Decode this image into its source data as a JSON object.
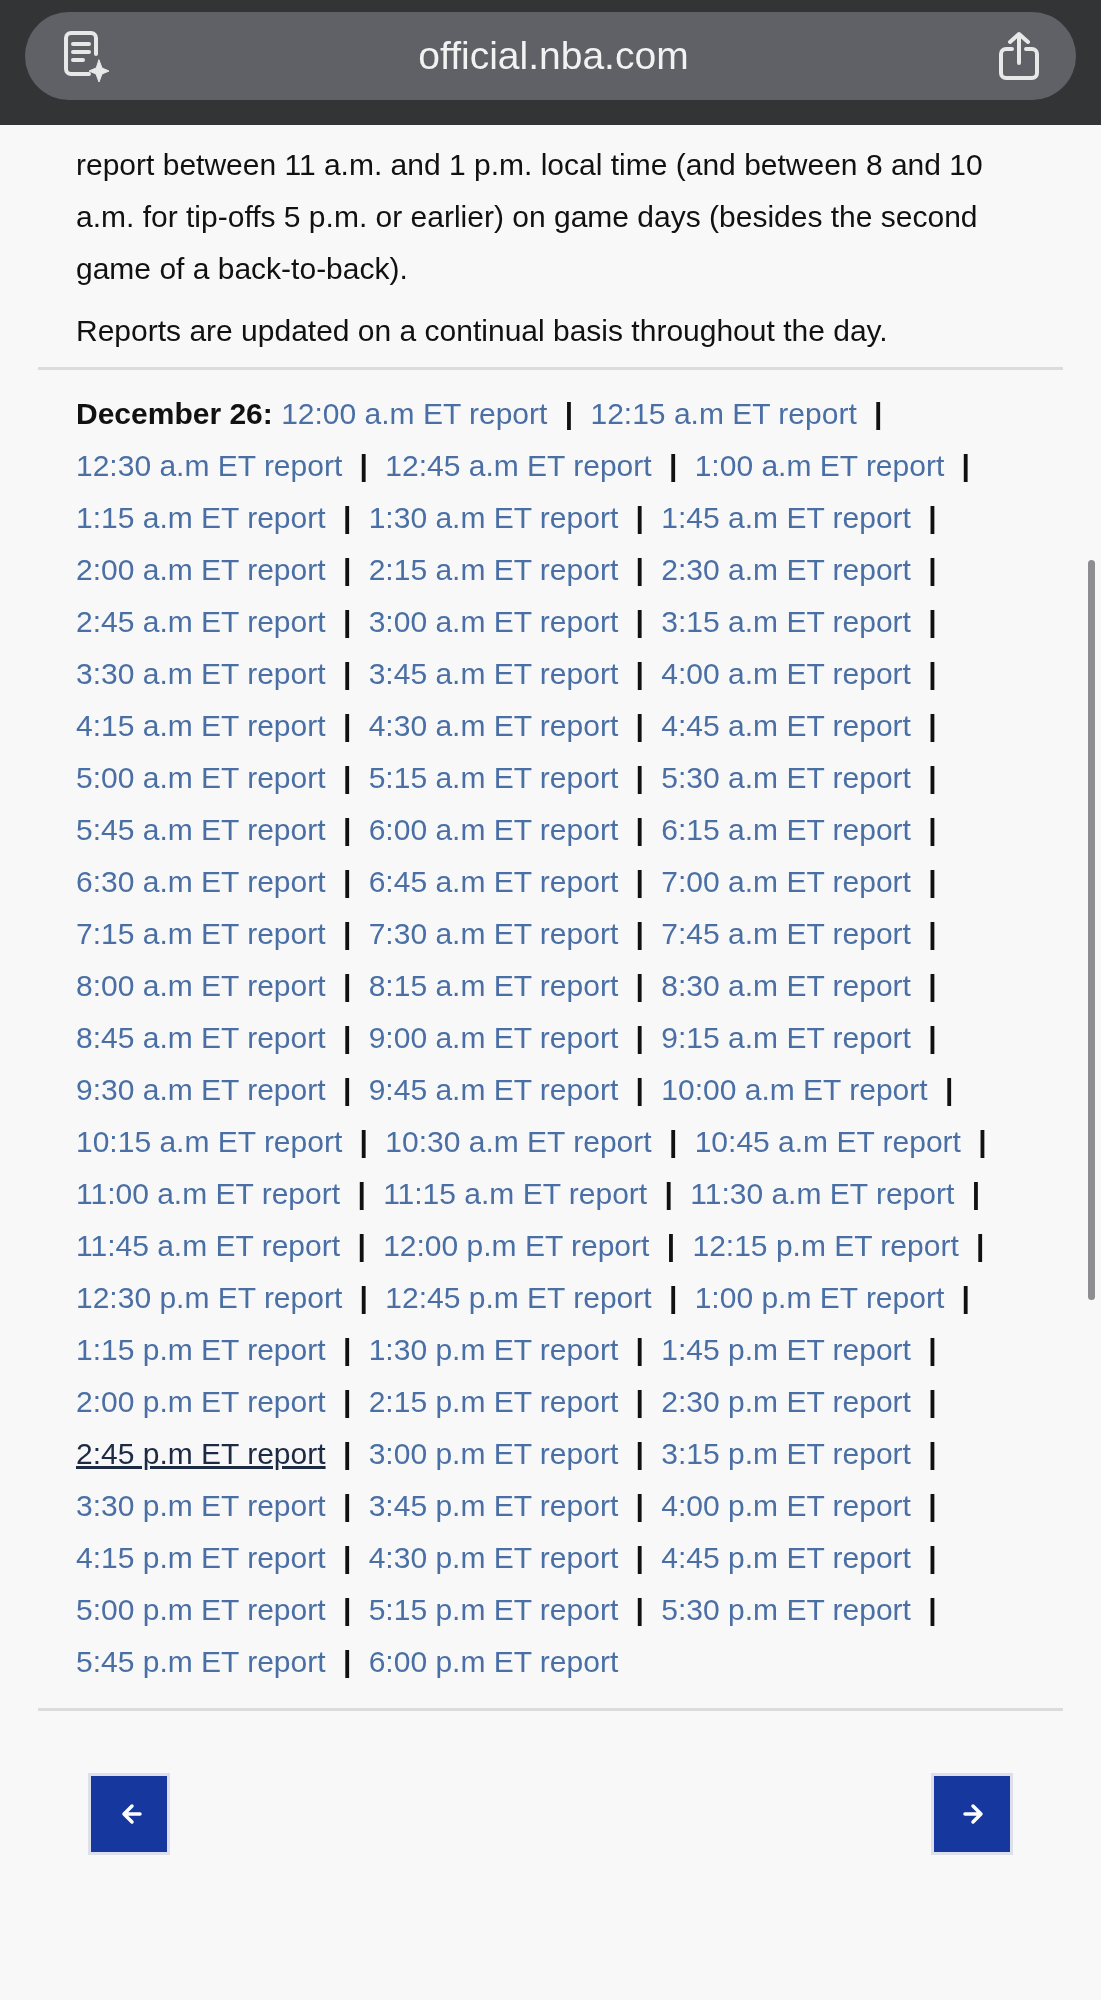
{
  "address_bar": {
    "url": "official.nba.com"
  },
  "intro": [
    "report between 11 a.m. and 1 p.m. local time (and between 8 and 10 a.m. for tip-offs 5 p.m. or earlier) on game days (besides the second game of a back-to-back).",
    "Reports are updated on a continual basis throughout the day."
  ],
  "reports": {
    "date_label": "December 26:",
    "links": [
      {
        "label": "12:00 a.m ET report",
        "hovered": false,
        "sep": "|"
      },
      {
        "label": "12:15 a.m ET report",
        "hovered": false,
        "sep": "|"
      },
      {
        "label": "12:30 a.m ET report",
        "hovered": false,
        "sep": "|"
      },
      {
        "label": "12:45 a.m ET report",
        "hovered": false,
        "sep": "|"
      },
      {
        "label": "1:00 a.m ET report",
        "hovered": false,
        "sep": "|"
      },
      {
        "label": "1:15 a.m ET report",
        "hovered": false,
        "sep": "|"
      },
      {
        "label": "1:30 a.m ET report",
        "hovered": false,
        "sep": "|"
      },
      {
        "label": "1:45 a.m ET report",
        "hovered": false,
        "sep": "|"
      },
      {
        "label": "2:00 a.m ET report",
        "hovered": false,
        "sep": "|"
      },
      {
        "label": "2:15 a.m ET report",
        "hovered": false,
        "sep": "|"
      },
      {
        "label": "2:30 a.m ET report",
        "hovered": false,
        "sep": "|"
      },
      {
        "label": "2:45 a.m ET report",
        "hovered": false,
        "sep": "|"
      },
      {
        "label": "3:00 a.m ET report",
        "hovered": false,
        "sep": "|"
      },
      {
        "label": "3:15 a.m ET report",
        "hovered": false,
        "sep": "|"
      },
      {
        "label": "3:30 a.m ET report",
        "hovered": false,
        "sep": "|"
      },
      {
        "label": "3:45 a.m ET report",
        "hovered": false,
        "sep": "|"
      },
      {
        "label": "4:00 a.m ET report",
        "hovered": false,
        "sep": "|"
      },
      {
        "label": "4:15 a.m ET report",
        "hovered": false,
        "sep": "|"
      },
      {
        "label": "4:30 a.m ET report",
        "hovered": false,
        "sep": "|"
      },
      {
        "label": "4:45 a.m ET report",
        "hovered": false,
        "sep": "|"
      },
      {
        "label": "5:00 a.m ET report",
        "hovered": false,
        "sep": "|"
      },
      {
        "label": "5:15 a.m ET report",
        "hovered": false,
        "sep": "|"
      },
      {
        "label": "5:30 a.m ET report",
        "hovered": false,
        "sep": "|"
      },
      {
        "label": "5:45 a.m ET report",
        "hovered": false,
        "sep": "|"
      },
      {
        "label": "6:00 a.m ET report",
        "hovered": false,
        "sep": "|"
      },
      {
        "label": "6:15 a.m ET report",
        "hovered": false,
        "sep": "|"
      },
      {
        "label": "6:30 a.m ET report",
        "hovered": false,
        "sep": "|"
      },
      {
        "label": "6:45 a.m ET report",
        "hovered": false,
        "sep": "|"
      },
      {
        "label": "7:00 a.m ET report",
        "hovered": false,
        "sep": "|"
      },
      {
        "label": "7:15 a.m ET report",
        "hovered": false,
        "sep": "|"
      },
      {
        "label": "7:30 a.m ET report",
        "hovered": false,
        "sep": "|"
      },
      {
        "label": "7:45 a.m ET report",
        "hovered": false,
        "sep": "|"
      },
      {
        "label": "8:00 a.m ET report",
        "hovered": false,
        "sep": "|"
      },
      {
        "label": "8:15 a.m ET report",
        "hovered": false,
        "sep": "|"
      },
      {
        "label": "8:30 a.m ET report",
        "hovered": false,
        "sep": "|"
      },
      {
        "label": "8:45 a.m ET report",
        "hovered": false,
        "sep": "|"
      },
      {
        "label": "9:00 a.m ET report",
        "hovered": false,
        "sep": "|"
      },
      {
        "label": "9:15 a.m ET report",
        "hovered": false,
        "sep": "|"
      },
      {
        "label": "9:30 a.m ET report",
        "hovered": false,
        "sep": "|"
      },
      {
        "label": "9:45 a.m ET report",
        "hovered": false,
        "sep": "|"
      },
      {
        "label": "10:00 a.m ET report",
        "hovered": false,
        "sep": "|"
      },
      {
        "label": "10:15 a.m ET report",
        "hovered": false,
        "sep": "|"
      },
      {
        "label": "10:30 a.m ET report",
        "hovered": false,
        "sep": "|"
      },
      {
        "label": "10:45 a.m ET report",
        "hovered": false,
        "sep": "|"
      },
      {
        "label": "11:00 a.m ET report",
        "hovered": false,
        "sep": "|"
      },
      {
        "label": "11:15 a.m ET report",
        "hovered": false,
        "sep": "|"
      },
      {
        "label": "11:30 a.m ET report",
        "hovered": false,
        "sep": "|"
      },
      {
        "label": "11:45 a.m ET report",
        "hovered": false,
        "sep": "|"
      },
      {
        "label": "12:00 p.m ET report",
        "hovered": false,
        "sep": "|"
      },
      {
        "label": "12:15 p.m ET report",
        "hovered": false,
        "sep": "|"
      },
      {
        "label": "12:30 p.m ET report",
        "hovered": false,
        "sep": "|"
      },
      {
        "label": "12:45 p.m ET report",
        "hovered": false,
        "sep": "|"
      },
      {
        "label": "1:00 p.m ET report",
        "hovered": false,
        "sep": "|"
      },
      {
        "label": "1:15 p.m ET report",
        "hovered": false,
        "sep": "|"
      },
      {
        "label": "1:30 p.m ET report",
        "hovered": false,
        "sep": "|"
      },
      {
        "label": "1:45 p.m ET report",
        "hovered": false,
        "sep": "|"
      },
      {
        "label": "2:00 p.m ET report",
        "hovered": false,
        "sep": "|"
      },
      {
        "label": "2:15 p.m ET report",
        "hovered": false,
        "sep": "|"
      },
      {
        "label": "2:30 p.m ET report",
        "hovered": false,
        "sep": "|"
      },
      {
        "label": "2:45 p.m ET report",
        "hovered": true,
        "sep": "|"
      },
      {
        "label": "3:00 p.m ET report",
        "hovered": false,
        "sep": "|"
      },
      {
        "label": "3:15 p.m ET report",
        "hovered": false,
        "sep": "|"
      },
      {
        "label": "3:30 p.m ET report",
        "hovered": false,
        "sep": "|"
      },
      {
        "label": "3:45 p.m ET report",
        "hovered": false,
        "sep": "|"
      },
      {
        "label": "4:00 p.m ET report",
        "hovered": false,
        "sep": "|"
      },
      {
        "label": "4:15 p.m ET report",
        "hovered": false,
        "sep": "|"
      },
      {
        "label": "4:30 p.m ET report",
        "hovered": false,
        "sep": "|"
      },
      {
        "label": "4:45 p.m ET report",
        "hovered": false,
        "sep": "|"
      },
      {
        "label": "5:00 p.m ET report",
        "hovered": false,
        "sep": "|"
      },
      {
        "label": "5:15 p.m ET report",
        "hovered": false,
        "sep": "|"
      },
      {
        "label": "5:30 p.m ET report",
        "hovered": false,
        "sep": "|"
      },
      {
        "label": "5:45 p.m ET report",
        "hovered": false,
        "sep": "|"
      },
      {
        "label": "6:00 p.m ET report",
        "hovered": false
      }
    ]
  },
  "pager": [
    {
      "kind": "left"
    },
    {
      "kind": "right"
    }
  ]
}
